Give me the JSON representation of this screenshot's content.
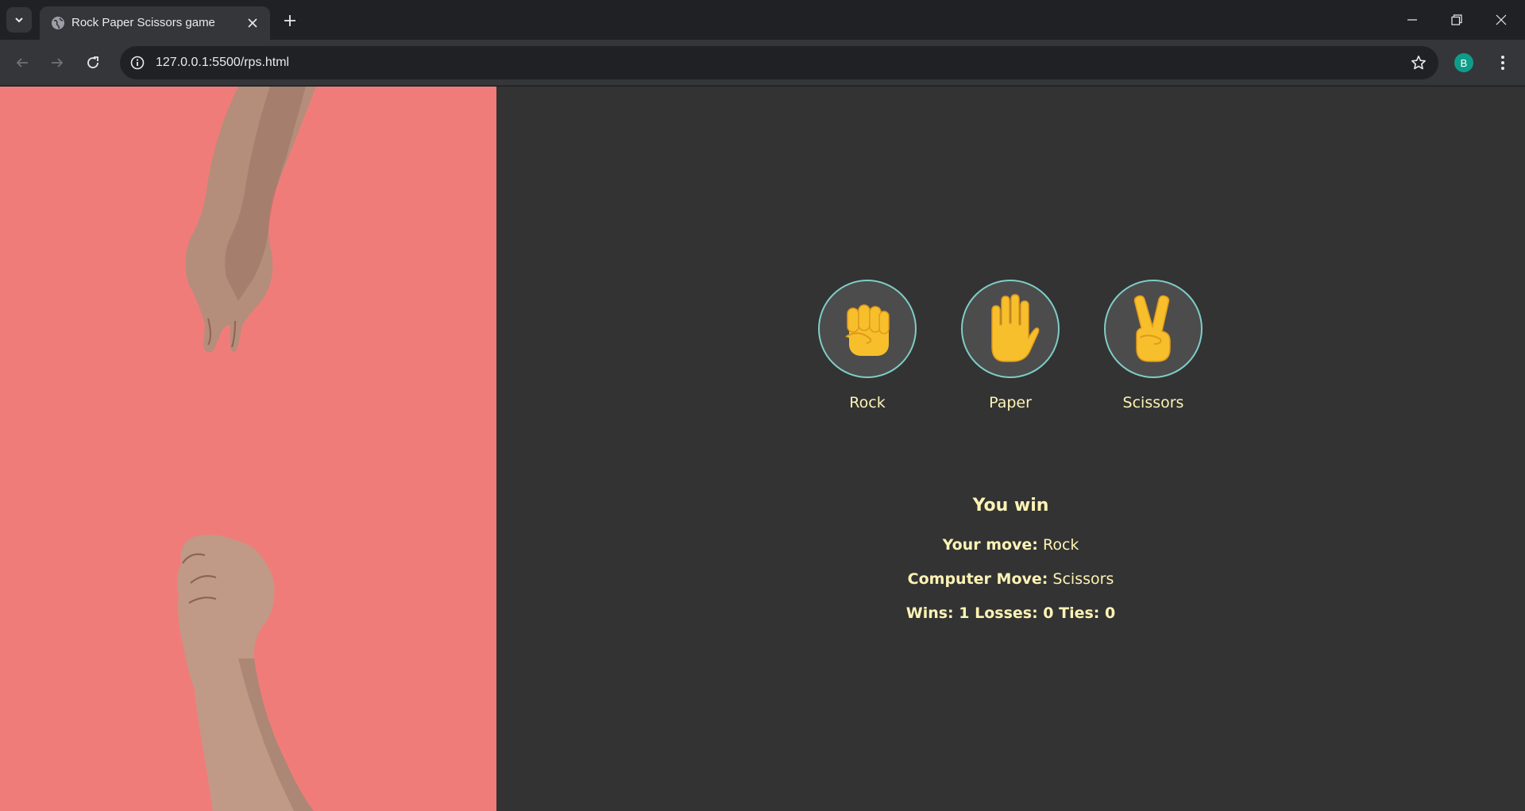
{
  "browser": {
    "tab_title": "Rock Paper Scissors game",
    "url": "127.0.0.1:5500/rps.html",
    "profile_initial": "B"
  },
  "game": {
    "moves": [
      {
        "label": "Rock",
        "icon": "raised-fist-icon"
      },
      {
        "label": "Paper",
        "icon": "raised-hand-icon"
      },
      {
        "label": "Scissors",
        "icon": "victory-hand-icon"
      }
    ],
    "result": "You win",
    "your_move_label": "Your move:",
    "your_move_value": "Rock",
    "computer_move_label": "Computer Move:",
    "computer_move_value": "Scissors",
    "score_text": "Wins: 1 Losses: 0 Ties: 0"
  },
  "colors": {
    "left_panel_bg": "#f07c7a",
    "right_panel_bg": "#333333",
    "text": "#fdf3b5",
    "button_ring": "#7fcdc7",
    "emoji_yellow": "#f7bf2c"
  }
}
